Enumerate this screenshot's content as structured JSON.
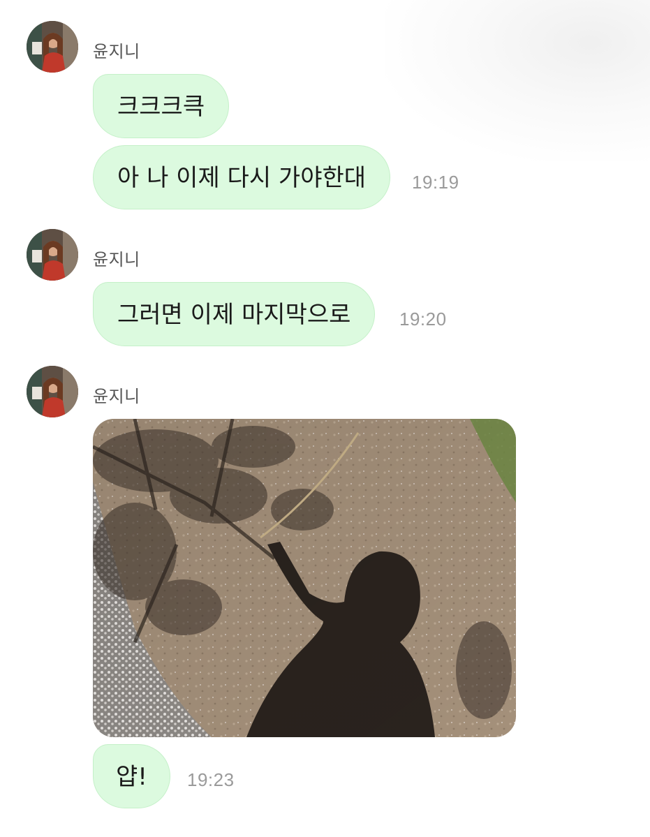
{
  "chat": {
    "groups": [
      {
        "sender": "윤지니",
        "messages": [
          {
            "text": "크크크큭"
          },
          {
            "text": "아 나 이제 다시 가야한대",
            "time": "19:19"
          }
        ]
      },
      {
        "sender": "윤지니",
        "messages": [
          {
            "text": "그러면 이제 마지막으로",
            "time": "19:20"
          }
        ]
      },
      {
        "sender": "윤지니",
        "messages": [
          {
            "type": "image",
            "icon": "shadow-photo"
          },
          {
            "text": "얍!",
            "time": "19:23"
          }
        ]
      }
    ]
  },
  "colors": {
    "bubble_bg": "#dcfadf",
    "bubble_border": "#c4f0c8",
    "time_text": "#9a9a9a",
    "sender_text": "#555555"
  }
}
